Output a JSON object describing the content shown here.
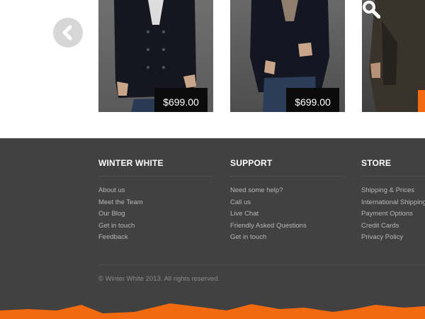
{
  "carousel": {
    "prev_icon": "chevron-left-icon",
    "zoom_icon": "search-icon",
    "products": [
      {
        "price": "$699.00"
      },
      {
        "price": "$699.00"
      },
      {
        "price": ""
      }
    ]
  },
  "footer": {
    "columns": [
      {
        "title": "WINTER WHITE",
        "links": [
          "About us",
          "Meet the Team",
          "Our Blog",
          "Get in touch",
          "Feedback"
        ]
      },
      {
        "title": "SUPPORT",
        "links": [
          "Need some help?",
          "Call us",
          "Live Chat",
          "Friendly Asked Questions",
          "Get in touch"
        ]
      },
      {
        "title": "STORE",
        "links": [
          "Shipping & Prices",
          "International Shipping",
          "Payment Options",
          "Credit Cards",
          "Privacy Policy"
        ]
      }
    ],
    "copyright": "© Winter White 2013. All rights reserved."
  },
  "colors": {
    "accent": "#f26a10",
    "footer_bg": "#414141",
    "price_bg": "#0b0b0c"
  }
}
